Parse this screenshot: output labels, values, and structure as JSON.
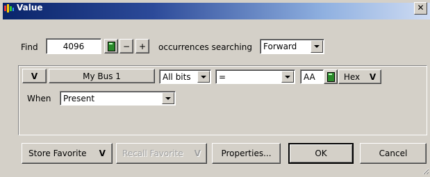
{
  "window": {
    "title": "Value",
    "close_glyph": "✕",
    "title_icon": "value-window-icon"
  },
  "find": {
    "label": "Find",
    "count": "4096",
    "minus": "−",
    "plus": "+",
    "occurrences_label": "occurrences searching",
    "direction": "Forward"
  },
  "condition": {
    "expand_glyph": "ᐯ",
    "bus_name": "My Bus 1",
    "bits": "All bits",
    "operator": "=",
    "value": "AA",
    "radix": "Hex",
    "radix_glyph": "ᐯ",
    "when_label": "When",
    "when_value": "Present"
  },
  "buttons": {
    "store_favorite": "Store Favorite",
    "recall_favorite": "Recall Favorite",
    "properties": "Properties...",
    "ok": "OK",
    "cancel": "Cancel",
    "chevron": "ᐯ"
  },
  "colors": {
    "titlebar_start": "#0a246a",
    "face": "#d4d0c8"
  }
}
